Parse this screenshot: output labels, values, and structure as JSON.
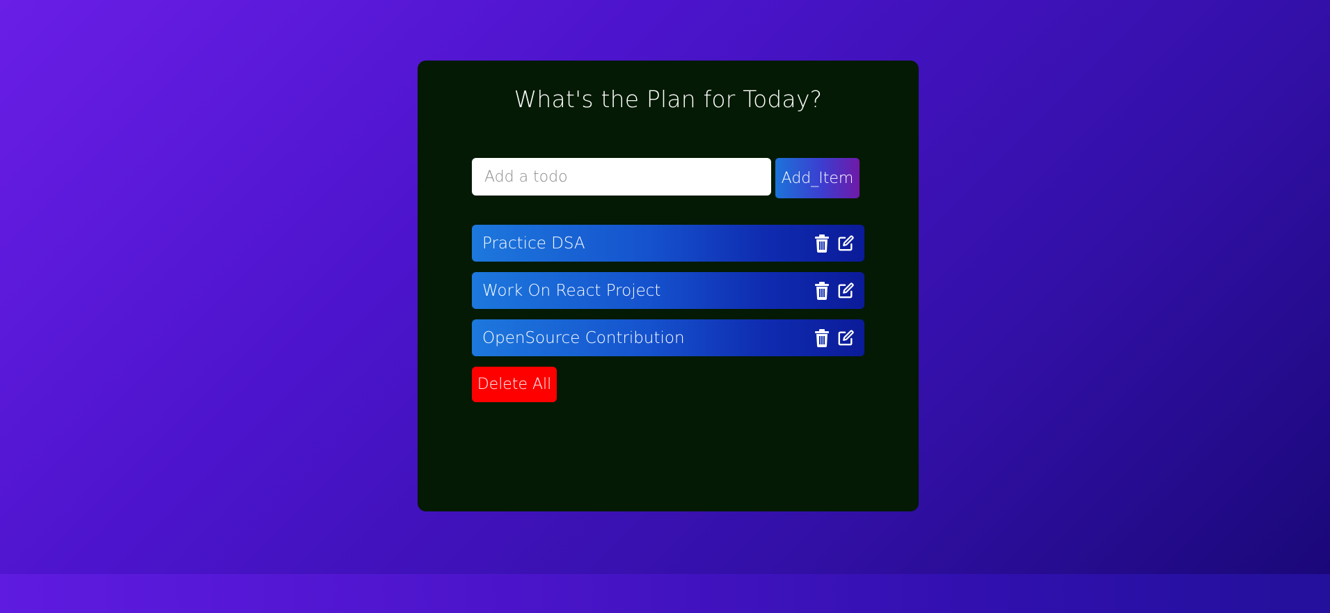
{
  "app": {
    "title": "What's the Plan for Today?"
  },
  "form": {
    "input_value": "",
    "input_placeholder": "Add a todo",
    "add_button_label": "Add_Item"
  },
  "todos": [
    {
      "text": "Practice DSA",
      "delete_icon": "trash-icon",
      "edit_icon": "edit-icon"
    },
    {
      "text": "Work On React Project",
      "delete_icon": "trash-icon",
      "edit_icon": "edit-icon"
    },
    {
      "text": "OpenSource Contribution",
      "delete_icon": "trash-icon",
      "edit_icon": "edit-icon"
    }
  ],
  "actions": {
    "delete_all_label": "Delete All"
  },
  "colors": {
    "card_background": "#041a04",
    "delete_all": "#ff0000",
    "accent_blue": "#1d78dd",
    "accent_purple": "#7019a8"
  }
}
